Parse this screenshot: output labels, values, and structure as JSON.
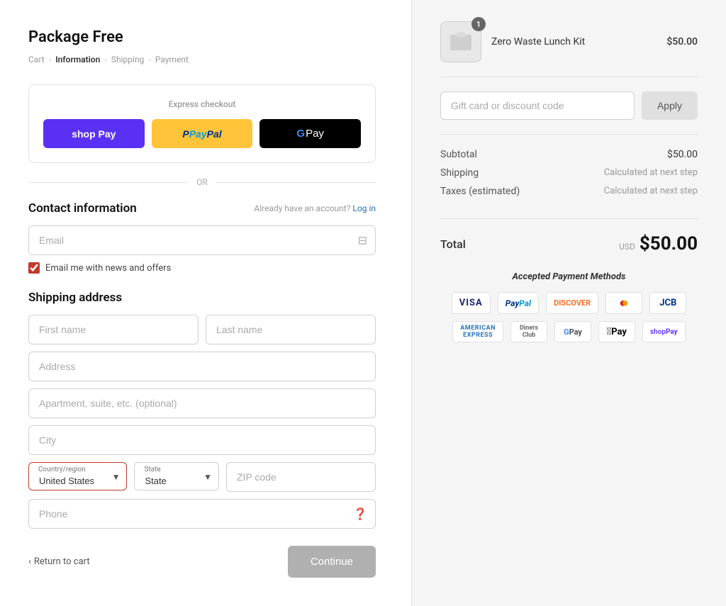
{
  "store": {
    "name": "Package Free"
  },
  "breadcrumb": {
    "cart": "Cart",
    "information": "Information",
    "shipping": "Shipping",
    "payment": "Payment"
  },
  "express": {
    "title": "Express checkout",
    "shop_pay": "shop Pay",
    "paypal": "PayPal",
    "gpay": "G Pay"
  },
  "or_label": "OR",
  "contact": {
    "title": "Contact information",
    "already_account": "Already have an account?",
    "login": "Log in",
    "email_placeholder": "Email",
    "checkbox_label": "Email me with news and offers"
  },
  "shipping": {
    "title": "Shipping address",
    "first_name_placeholder": "First name",
    "last_name_placeholder": "Last name",
    "address_placeholder": "Address",
    "apt_placeholder": "Apartment, suite, etc. (optional)",
    "city_placeholder": "City",
    "country_label": "Country/region",
    "country_value": "United States",
    "state_label": "State",
    "state_placeholder": "State",
    "zip_placeholder": "ZIP code",
    "phone_placeholder": "Phone"
  },
  "footer": {
    "return_label": "Return to cart",
    "continue_label": "Continue"
  },
  "order": {
    "item_name": "Zero Waste Lunch Kit",
    "item_price": "$50.00",
    "item_qty": "1"
  },
  "discount": {
    "placeholder": "Gift card or discount code",
    "apply_label": "Apply"
  },
  "summary": {
    "subtotal_label": "Subtotal",
    "subtotal_value": "$50.00",
    "shipping_label": "Shipping",
    "shipping_value": "Calculated at next step",
    "taxes_label": "Taxes (estimated)",
    "taxes_value": "Calculated at next step",
    "total_label": "Total",
    "total_currency": "USD",
    "total_value": "$50.00"
  },
  "payment_methods": {
    "title": "Accepted Payment Methods",
    "logos": [
      "VISA",
      "PayPal",
      "DISCOVER",
      "Mastercard",
      "JCB",
      "AMERICAN EXPRESS",
      "Diners Club",
      "G Pay",
      "Apple Pay",
      "shopPay"
    ]
  }
}
